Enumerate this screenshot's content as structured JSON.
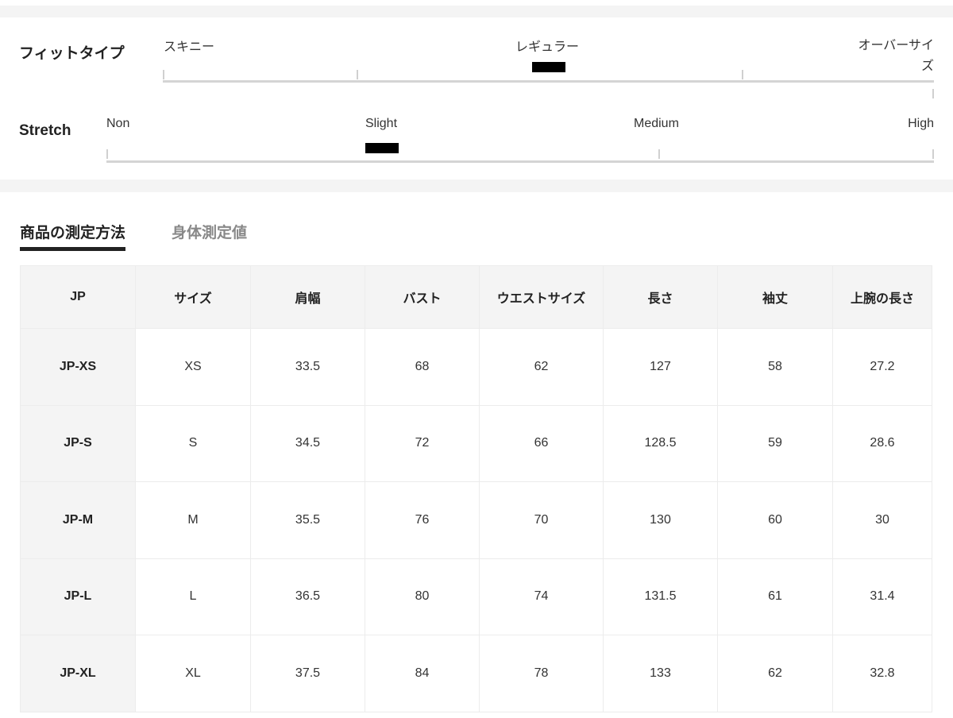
{
  "fit": {
    "label": "フィットタイプ",
    "options": [
      "スキニー",
      "レギュラー",
      "オーバーサイズ"
    ],
    "selected": "レギュラー"
  },
  "stretch": {
    "label": "Stretch",
    "options": [
      "Non",
      "Slight",
      "Medium",
      "High"
    ],
    "selected": "Slight"
  },
  "tabs": [
    {
      "label": "商品の測定方法",
      "active": true
    },
    {
      "label": "身体測定値",
      "active": false
    }
  ],
  "table": {
    "headers": [
      "JP",
      "サイズ",
      "肩幅",
      "バスト",
      "ウエストサイズ",
      "長さ",
      "袖丈",
      "上腕の長さ"
    ],
    "rows": [
      [
        "JP-XS",
        "XS",
        "33.5",
        "68",
        "62",
        "127",
        "58",
        "27.2"
      ],
      [
        "JP-S",
        "S",
        "34.5",
        "72",
        "66",
        "128.5",
        "59",
        "28.6"
      ],
      [
        "JP-M",
        "M",
        "35.5",
        "76",
        "70",
        "130",
        "60",
        "30"
      ],
      [
        "JP-L",
        "L",
        "36.5",
        "80",
        "74",
        "131.5",
        "61",
        "31.4"
      ],
      [
        "JP-XL",
        "XL",
        "37.5",
        "84",
        "78",
        "133",
        "62",
        "32.8"
      ]
    ]
  },
  "colors": {
    "marker": "#000000",
    "band": "#f4f4f4",
    "track": "#d4d4d4"
  }
}
